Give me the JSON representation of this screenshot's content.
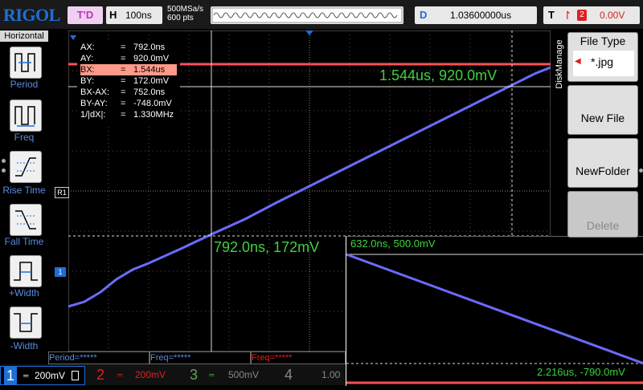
{
  "header": {
    "logo": "RIGOL",
    "trigger_status": "T'D",
    "horizontal_label": "H",
    "timebase": "100ns",
    "sample_rate": "500MSa/s",
    "memory_depth": "600 pts",
    "delay_label": "D",
    "delay_value": "1.03600000us",
    "trigger_label": "T",
    "trigger_source": "2",
    "trigger_level": "0.00V"
  },
  "left_menu": {
    "title": "Horizontal",
    "items": [
      {
        "label": "Period",
        "icon": "period-icon"
      },
      {
        "label": "Freq",
        "icon": "freq-icon"
      },
      {
        "label": "Rise Time",
        "icon": "rise-time-icon"
      },
      {
        "label": "Fall Time",
        "icon": "fall-time-icon"
      },
      {
        "label": "+Width",
        "icon": "positive-width-icon"
      },
      {
        "label": "-Width",
        "icon": "negative-width-icon"
      }
    ]
  },
  "right_menu": {
    "tab_label": "DiskManage",
    "title": "File Type",
    "file_type_value": "*.jpg",
    "new_file": "New File",
    "new_folder": "NewFolder",
    "delete": "Delete"
  },
  "cursor_measurements": [
    {
      "key": "AX:",
      "eq": "=",
      "val": "792.0ns"
    },
    {
      "key": "AY:",
      "eq": "=",
      "val": "920.0mV"
    },
    {
      "key": "BX:",
      "eq": "=",
      "val": "1.544us"
    },
    {
      "key": "BY:",
      "eq": "=",
      "val": "172.0mV"
    },
    {
      "key": "BX-AX:",
      "eq": "=",
      "val": "752.0ns"
    },
    {
      "key": "BY-AY:",
      "eq": "=",
      "val": "-748.0mV"
    },
    {
      "key": "1/|dX|:",
      "eq": "=",
      "val": "1.330MHz"
    }
  ],
  "annotations": {
    "cursor_b": "1.544us, 920.0mV",
    "cursor_a": "792.0ns, 172mV",
    "zoom_start": "632.0ns, 500.0mV",
    "zoom_end": "2.216us, -790.0mV"
  },
  "channel_markers": {
    "ref": "R1",
    "ch1": "1"
  },
  "bottom_measurements": [
    {
      "label": "Period=*****",
      "color": "#5a8be0"
    },
    {
      "label": "Freq=*****",
      "color": "#5a8be0"
    },
    {
      "label": "Freq=*****",
      "color": "#e02020"
    }
  ],
  "channels": [
    {
      "number": "1",
      "scale": "200mV",
      "color": "#1e6fd6",
      "active": true
    },
    {
      "number": "2",
      "scale": "200mV",
      "color": "#e02020",
      "active": false
    },
    {
      "number": "3",
      "scale": "500mV",
      "color": "#55aa55",
      "active": false
    },
    {
      "number": "4",
      "scale": "1.00",
      "color": "#888888",
      "active": false
    }
  ],
  "colors": {
    "ch1_trace": "#6b6bff",
    "ch2_trace": "#ff5050",
    "annotation": "#3fd13f",
    "brand": "#1e6fd6"
  }
}
